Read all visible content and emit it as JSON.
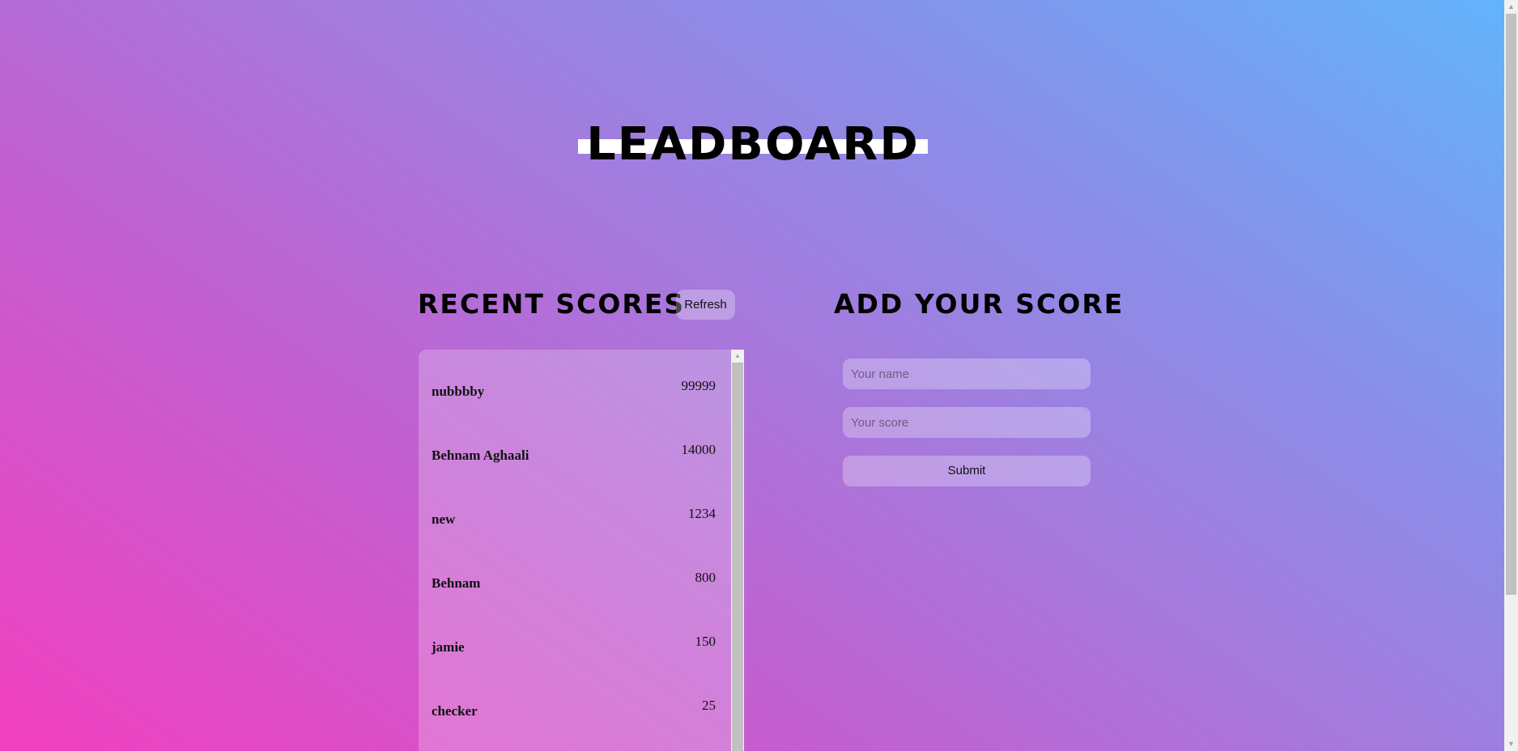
{
  "title": "LEADBOARD",
  "recent": {
    "heading": "RECENT SCORES",
    "refresh_label": "Refresh",
    "scores": [
      {
        "name": "nubbbby",
        "score": "99999"
      },
      {
        "name": "Behnam Aghaali",
        "score": "14000"
      },
      {
        "name": "new",
        "score": "1234"
      },
      {
        "name": "Behnam",
        "score": "800"
      },
      {
        "name": "jamie",
        "score": "150"
      },
      {
        "name": "checker",
        "score": "25"
      }
    ]
  },
  "add": {
    "heading": "ADD YOUR SCORE",
    "name_placeholder": "Your name",
    "score_placeholder": "Your score",
    "submit_label": "Submit"
  },
  "icons": {
    "scroll_up": "chevron-up-icon",
    "scroll_down": "chevron-down-icon"
  },
  "colors": {
    "gradient_start": "#f23fbf",
    "gradient_mid": "#a778dc",
    "gradient_end": "#62b4fb",
    "title_bar": "#ffffff"
  }
}
